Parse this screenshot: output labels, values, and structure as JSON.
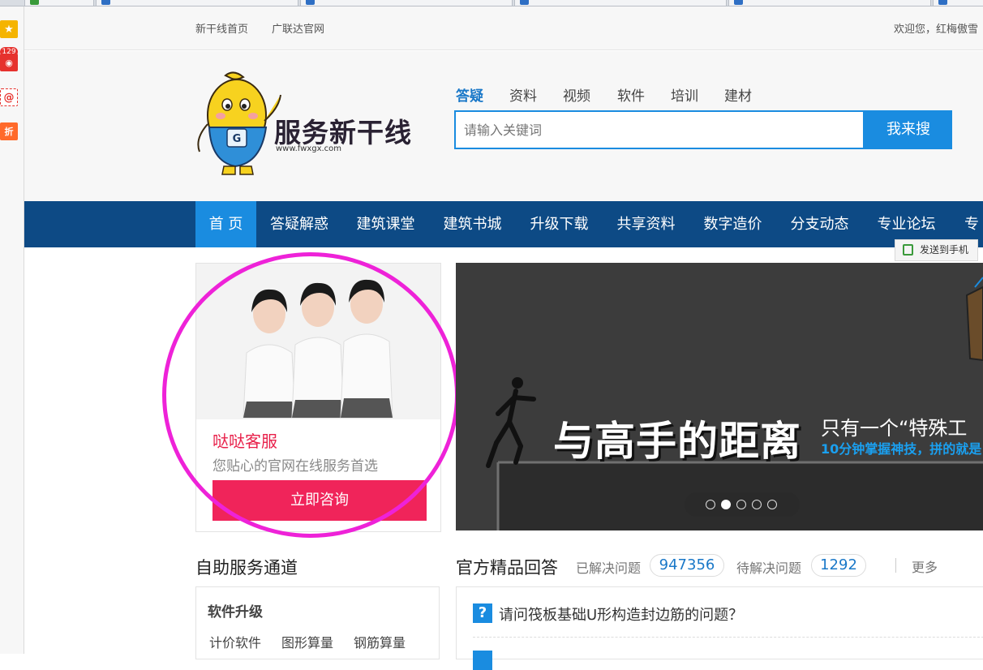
{
  "browser": {
    "tabs": [
      "",
      "",
      "",
      "",
      "",
      "",
      "",
      ""
    ],
    "sidebar_badge": "129",
    "sidebar_icons": [
      "star-icon",
      "weibo-icon",
      "mail-icon",
      "taobao-icon"
    ],
    "sidebar_mail_glyph": "@",
    "sidebar_tb_glyph": "折"
  },
  "topbar": {
    "links": [
      "新干线首页",
      "广联达官网"
    ],
    "welcome": "欢迎您，红梅傲雪"
  },
  "header": {
    "logo_text": "服务新干线",
    "logo_url": "www.fwxgx.com",
    "search_tabs": [
      "答疑",
      "资料",
      "视频",
      "软件",
      "培训",
      "建材"
    ],
    "active_tab": "答疑",
    "search_placeholder": "请输入关键词",
    "search_button": "我来搜"
  },
  "nav": {
    "items": [
      "首 页",
      "答疑解惑",
      "建筑课堂",
      "建筑书城",
      "升级下载",
      "共享资料",
      "数字造价",
      "分支动态",
      "专业论坛",
      "专"
    ],
    "send_to_phone": "发送到手机"
  },
  "service_card": {
    "title": "哒哒客服",
    "subtitle": "您贴心的官网在线服务首选",
    "button": "立即咨询"
  },
  "banner": {
    "headline": "与高手的距离",
    "tagline": "只有一个“特殊工",
    "subline": "10分钟掌握神技，拼的就是",
    "slide_count": 5,
    "active_slide": 2
  },
  "self_service": {
    "title": "自助服务通道",
    "section_heading": "软件升级",
    "links": [
      "计价软件",
      "图形算量",
      "钢筋算量"
    ]
  },
  "qa": {
    "title": "官方精品回答",
    "solved_label": "已解决问题",
    "solved_count": "947356",
    "pending_label": "待解决问题",
    "pending_count": "1292",
    "more": "更多",
    "questions": [
      "请问筏板基础U形构造封边筋的问题？"
    ],
    "question_icon": "?"
  },
  "colors": {
    "brand_blue": "#1a8ce0",
    "nav_blue": "#0d4a85",
    "accent_pink": "#f0245a",
    "annotation_magenta": "#ee22d8"
  }
}
